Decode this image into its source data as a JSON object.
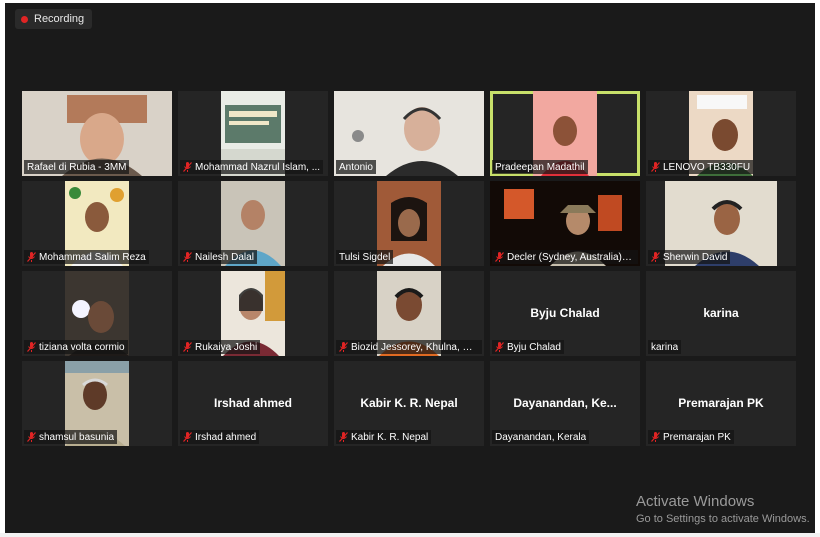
{
  "recording": {
    "label": "Recording"
  },
  "participants": [
    {
      "name": "Rafael di Rubia - 3MM",
      "muted": false,
      "video": true,
      "active": false
    },
    {
      "name": "Mohammad Nazrul Islam, ...",
      "muted": true,
      "video": true,
      "active": false
    },
    {
      "name": "Antonio",
      "muted": false,
      "video": true,
      "active": false
    },
    {
      "name": "Pradeepan Madathil",
      "muted": false,
      "video": true,
      "active": true
    },
    {
      "name": "LENOVO TB330FU",
      "muted": true,
      "video": true,
      "active": false
    },
    {
      "name": "Mohammad Salim Reza",
      "muted": true,
      "video": true,
      "active": false
    },
    {
      "name": "Nailesh Dalal",
      "muted": true,
      "video": true,
      "active": false
    },
    {
      "name": "Tulsi Sigdel",
      "muted": false,
      "video": true,
      "active": false
    },
    {
      "name": "Decler (Sydney, Australia)_...",
      "muted": true,
      "video": true,
      "active": false
    },
    {
      "name": "Sherwin David",
      "muted": true,
      "video": true,
      "active": false
    },
    {
      "name": "tiziana volta cormio",
      "muted": true,
      "video": true,
      "active": false
    },
    {
      "name": "Rukaiya Joshi",
      "muted": true,
      "video": true,
      "active": false
    },
    {
      "name": "Biozid Jessorey, Khulna, Ba...",
      "muted": true,
      "video": true,
      "active": false
    },
    {
      "name": "Byju Chalad",
      "display": "Byju Chalad",
      "muted": true,
      "video": false,
      "active": false
    },
    {
      "name": "karina",
      "display": "karina",
      "muted": false,
      "video": false,
      "active": false
    },
    {
      "name": "shamsul basunia",
      "muted": true,
      "video": true,
      "active": false
    },
    {
      "name": "Irshad ahmed",
      "display": "Irshad ahmed",
      "muted": true,
      "video": false,
      "active": false
    },
    {
      "name": "Kabir K. R. Nepal",
      "display": "Kabir K. R. Nepal",
      "muted": true,
      "video": false,
      "active": false
    },
    {
      "name": "Dayanandan, Kerala",
      "display": "Dayanandan,  Ke...",
      "muted": false,
      "video": false,
      "active": false
    },
    {
      "name": "Premarajan PK",
      "display": "Premarajan PK",
      "muted": true,
      "video": false,
      "active": false
    }
  ],
  "watermark": {
    "title": "Activate Windows",
    "subtitle": "Go to Settings to activate Windows."
  },
  "colors": {
    "active_border": "#c8e06a",
    "muted_icon": "#e02424",
    "recording_dot": "#e02424"
  }
}
